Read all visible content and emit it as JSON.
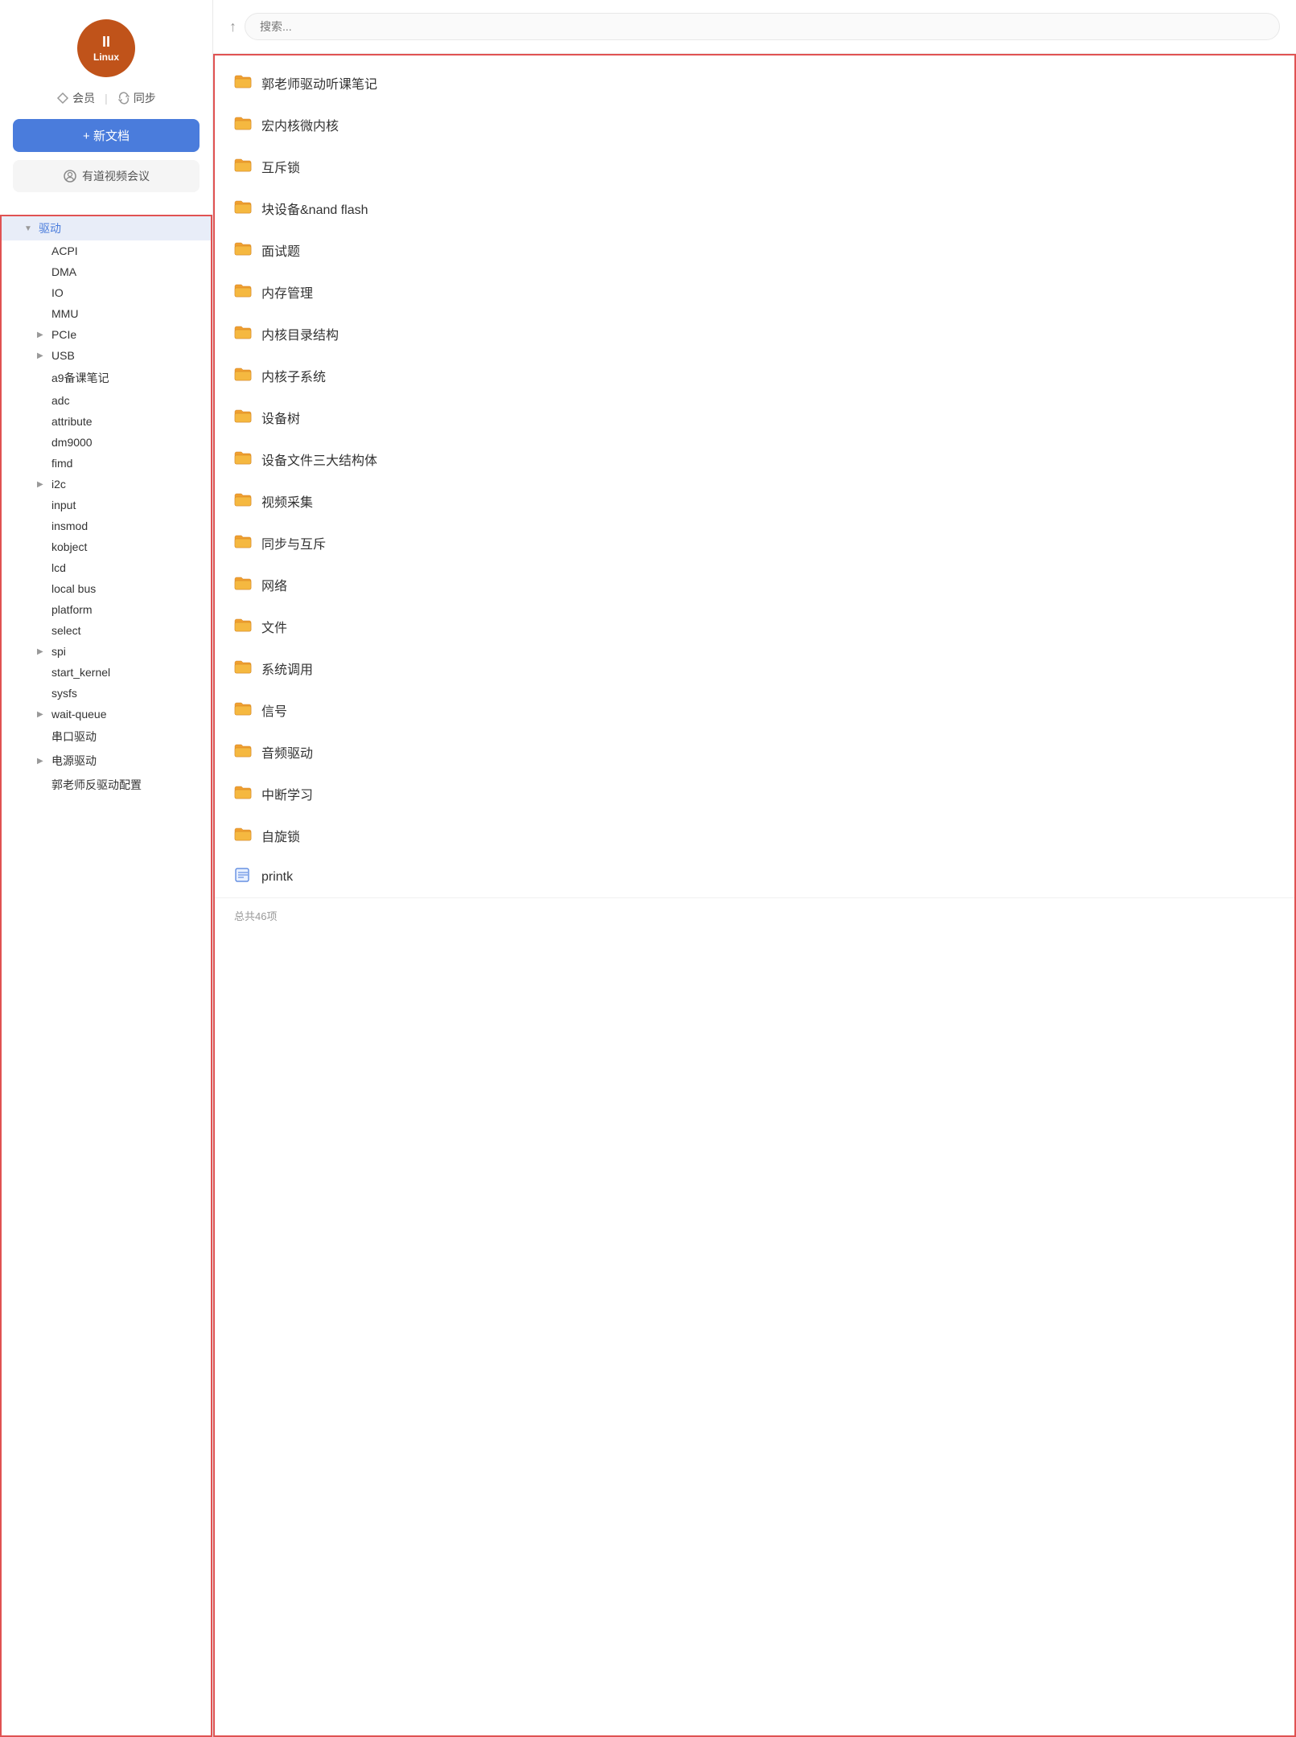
{
  "app": {
    "title": "Linux"
  },
  "avatar": {
    "line1": "II",
    "line2": "Linux"
  },
  "sidebar": {
    "member_label": "会员",
    "sync_label": "同步",
    "new_doc_label": "+ 新文档",
    "meeting_label": "有道视频会议",
    "search_placeholder": "搜索...",
    "tree": {
      "root_label": "驱动",
      "items": [
        {
          "id": "acpi",
          "label": "ACPI",
          "indent": 2,
          "expandable": false
        },
        {
          "id": "dma",
          "label": "DMA",
          "indent": 2,
          "expandable": false
        },
        {
          "id": "io",
          "label": "IO",
          "indent": 2,
          "expandable": false
        },
        {
          "id": "mmu",
          "label": "MMU",
          "indent": 2,
          "expandable": false
        },
        {
          "id": "pcie",
          "label": "PCIe",
          "indent": 2,
          "expandable": true
        },
        {
          "id": "usb",
          "label": "USB",
          "indent": 2,
          "expandable": true
        },
        {
          "id": "a9",
          "label": "a9备课笔记",
          "indent": 2,
          "expandable": false
        },
        {
          "id": "adc",
          "label": "adc",
          "indent": 2,
          "expandable": false
        },
        {
          "id": "attribute",
          "label": "attribute",
          "indent": 2,
          "expandable": false
        },
        {
          "id": "dm9000",
          "label": "dm9000",
          "indent": 2,
          "expandable": false
        },
        {
          "id": "fimd",
          "label": "fimd",
          "indent": 2,
          "expandable": false
        },
        {
          "id": "i2c",
          "label": "i2c",
          "indent": 2,
          "expandable": true
        },
        {
          "id": "input",
          "label": "input",
          "indent": 2,
          "expandable": false
        },
        {
          "id": "insmod",
          "label": "insmod",
          "indent": 2,
          "expandable": false
        },
        {
          "id": "kobject",
          "label": "kobject",
          "indent": 2,
          "expandable": false
        },
        {
          "id": "lcd",
          "label": "lcd",
          "indent": 2,
          "expandable": false
        },
        {
          "id": "local_bus",
          "label": "local bus",
          "indent": 2,
          "expandable": false
        },
        {
          "id": "platform",
          "label": "platform",
          "indent": 2,
          "expandable": false
        },
        {
          "id": "select",
          "label": "select",
          "indent": 2,
          "expandable": false
        },
        {
          "id": "spi",
          "label": "spi",
          "indent": 2,
          "expandable": true
        },
        {
          "id": "start_kernel",
          "label": "start_kernel",
          "indent": 2,
          "expandable": false
        },
        {
          "id": "sysfs",
          "label": "sysfs",
          "indent": 2,
          "expandable": false
        },
        {
          "id": "wait_queue",
          "label": "wait-queue",
          "indent": 2,
          "expandable": true
        },
        {
          "id": "serial",
          "label": "串口驱动",
          "indent": 2,
          "expandable": false
        },
        {
          "id": "power",
          "label": "电源驱动",
          "indent": 2,
          "expandable": true
        },
        {
          "id": "guo",
          "label": "郭老师反驱动配置",
          "indent": 2,
          "expandable": false
        }
      ]
    }
  },
  "main": {
    "content_items": [
      {
        "id": "guo_notes",
        "label": "郭老师驱动听课笔记",
        "type": "folder",
        "icon": "folder-yellow"
      },
      {
        "id": "macro_micro",
        "label": "宏内核微内核",
        "type": "folder",
        "icon": "folder-yellow"
      },
      {
        "id": "mutex",
        "label": "互斥锁",
        "type": "folder",
        "icon": "folder-yellow"
      },
      {
        "id": "block_nand",
        "label": "块设备&nand flash",
        "type": "folder",
        "icon": "folder-yellow"
      },
      {
        "id": "interview",
        "label": "面试题",
        "type": "folder",
        "icon": "folder-yellow"
      },
      {
        "id": "memory",
        "label": "内存管理",
        "type": "folder",
        "icon": "folder-yellow"
      },
      {
        "id": "kernel_dir",
        "label": "内核目录结构",
        "type": "folder",
        "icon": "folder-yellow"
      },
      {
        "id": "kernel_subsys",
        "label": "内核子系统",
        "type": "folder",
        "icon": "folder-yellow"
      },
      {
        "id": "device_tree",
        "label": "设备树",
        "type": "folder",
        "icon": "folder-yellow"
      },
      {
        "id": "device_file",
        "label": "设备文件三大结构体",
        "type": "folder",
        "icon": "folder-yellow"
      },
      {
        "id": "video_capture",
        "label": "视频采集",
        "type": "folder",
        "icon": "folder-yellow"
      },
      {
        "id": "sync_mutex",
        "label": "同步与互斥",
        "type": "folder",
        "icon": "folder-yellow"
      },
      {
        "id": "network",
        "label": "网络",
        "type": "folder",
        "icon": "folder-yellow"
      },
      {
        "id": "file",
        "label": "文件",
        "type": "folder",
        "icon": "folder-yellow"
      },
      {
        "id": "syscall",
        "label": "系统调用",
        "type": "folder",
        "icon": "folder-yellow"
      },
      {
        "id": "signal",
        "label": "信号",
        "type": "folder",
        "icon": "folder-yellow"
      },
      {
        "id": "audio",
        "label": "音频驱动",
        "type": "folder",
        "icon": "folder-yellow"
      },
      {
        "id": "interrupt",
        "label": "中断学习",
        "type": "folder",
        "icon": "folder-yellow"
      },
      {
        "id": "spinlock",
        "label": "自旋锁",
        "type": "folder",
        "icon": "folder-yellow"
      },
      {
        "id": "printk",
        "label": "printk",
        "type": "file",
        "icon": "file-blue"
      }
    ],
    "footer": "总共46项"
  }
}
